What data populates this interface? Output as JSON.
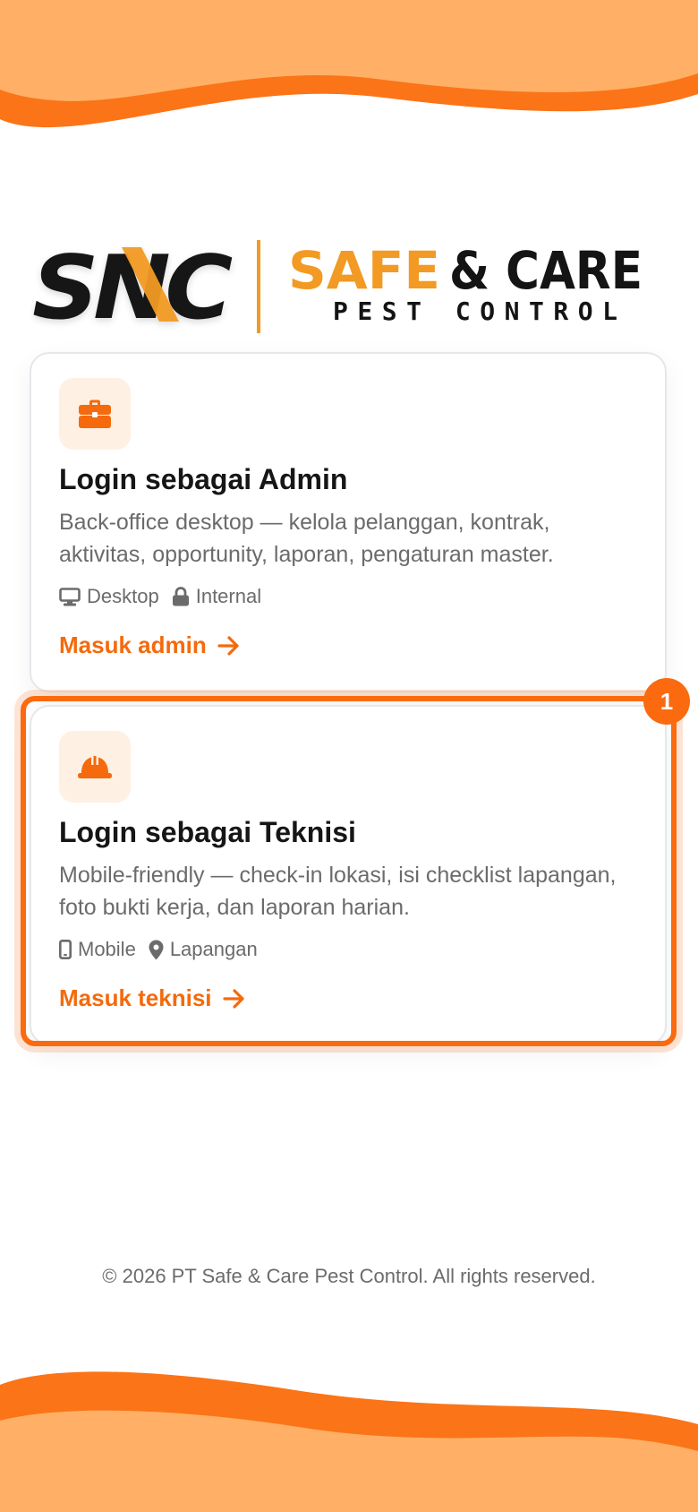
{
  "brand": {
    "logo_mark": "SNC",
    "logo_name": "SAFE & CARE",
    "logo_tagline": "PEST CONTROL",
    "accent_color": "#fb6a0f",
    "wave_light_color": "#ffb066"
  },
  "cards": [
    {
      "icon": "briefcase-icon",
      "title": "Login sebagai Admin",
      "description": "Back-office desktop — kelola pelanggan, kontrak, aktivitas, opportunity, laporan, pengaturan master.",
      "tags": [
        {
          "icon": "desktop-icon",
          "label": "Desktop"
        },
        {
          "icon": "lock-icon",
          "label": "Internal"
        }
      ],
      "cta": "Masuk admin"
    },
    {
      "icon": "hard-hat-icon",
      "title": "Login sebagai Teknisi",
      "description": "Mobile-friendly — check-in lokasi, isi checklist lapangan, foto bukti kerja, dan laporan harian.",
      "tags": [
        {
          "icon": "mobile-icon",
          "label": "Mobile"
        },
        {
          "icon": "location-pin-icon",
          "label": "Lapangan"
        }
      ],
      "cta": "Masuk teknisi"
    }
  ],
  "highlight_badge": "1",
  "footer": "© 2026 PT Safe & Care Pest Control. All rights reserved."
}
